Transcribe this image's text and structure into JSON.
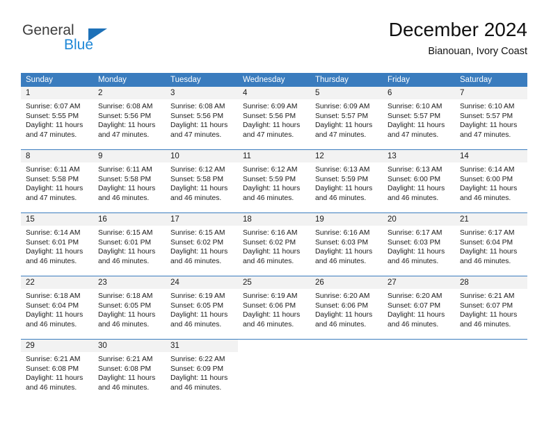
{
  "logo": {
    "word_top": "General",
    "word_bottom": "Blue",
    "triangle_color": "#1e71b8",
    "blue_color": "#1e87d6"
  },
  "header": {
    "month_title": "December 2024",
    "location": "Bianouan, Ivory Coast"
  },
  "theme": {
    "header_blue": "#3a7cbe",
    "day_number_bg": "#f2f2f2",
    "text": "#1a1a1a"
  },
  "calendar": {
    "weekdays": [
      "Sunday",
      "Monday",
      "Tuesday",
      "Wednesday",
      "Thursday",
      "Friday",
      "Saturday"
    ],
    "weeks": [
      [
        {
          "day": "1",
          "sunrise": "Sunrise: 6:07 AM",
          "sunset": "Sunset: 5:55 PM",
          "daylight1": "Daylight: 11 hours",
          "daylight2": "and 47 minutes."
        },
        {
          "day": "2",
          "sunrise": "Sunrise: 6:08 AM",
          "sunset": "Sunset: 5:56 PM",
          "daylight1": "Daylight: 11 hours",
          "daylight2": "and 47 minutes."
        },
        {
          "day": "3",
          "sunrise": "Sunrise: 6:08 AM",
          "sunset": "Sunset: 5:56 PM",
          "daylight1": "Daylight: 11 hours",
          "daylight2": "and 47 minutes."
        },
        {
          "day": "4",
          "sunrise": "Sunrise: 6:09 AM",
          "sunset": "Sunset: 5:56 PM",
          "daylight1": "Daylight: 11 hours",
          "daylight2": "and 47 minutes."
        },
        {
          "day": "5",
          "sunrise": "Sunrise: 6:09 AM",
          "sunset": "Sunset: 5:57 PM",
          "daylight1": "Daylight: 11 hours",
          "daylight2": "and 47 minutes."
        },
        {
          "day": "6",
          "sunrise": "Sunrise: 6:10 AM",
          "sunset": "Sunset: 5:57 PM",
          "daylight1": "Daylight: 11 hours",
          "daylight2": "and 47 minutes."
        },
        {
          "day": "7",
          "sunrise": "Sunrise: 6:10 AM",
          "sunset": "Sunset: 5:57 PM",
          "daylight1": "Daylight: 11 hours",
          "daylight2": "and 47 minutes."
        }
      ],
      [
        {
          "day": "8",
          "sunrise": "Sunrise: 6:11 AM",
          "sunset": "Sunset: 5:58 PM",
          "daylight1": "Daylight: 11 hours",
          "daylight2": "and 47 minutes."
        },
        {
          "day": "9",
          "sunrise": "Sunrise: 6:11 AM",
          "sunset": "Sunset: 5:58 PM",
          "daylight1": "Daylight: 11 hours",
          "daylight2": "and 46 minutes."
        },
        {
          "day": "10",
          "sunrise": "Sunrise: 6:12 AM",
          "sunset": "Sunset: 5:58 PM",
          "daylight1": "Daylight: 11 hours",
          "daylight2": "and 46 minutes."
        },
        {
          "day": "11",
          "sunrise": "Sunrise: 6:12 AM",
          "sunset": "Sunset: 5:59 PM",
          "daylight1": "Daylight: 11 hours",
          "daylight2": "and 46 minutes."
        },
        {
          "day": "12",
          "sunrise": "Sunrise: 6:13 AM",
          "sunset": "Sunset: 5:59 PM",
          "daylight1": "Daylight: 11 hours",
          "daylight2": "and 46 minutes."
        },
        {
          "day": "13",
          "sunrise": "Sunrise: 6:13 AM",
          "sunset": "Sunset: 6:00 PM",
          "daylight1": "Daylight: 11 hours",
          "daylight2": "and 46 minutes."
        },
        {
          "day": "14",
          "sunrise": "Sunrise: 6:14 AM",
          "sunset": "Sunset: 6:00 PM",
          "daylight1": "Daylight: 11 hours",
          "daylight2": "and 46 minutes."
        }
      ],
      [
        {
          "day": "15",
          "sunrise": "Sunrise: 6:14 AM",
          "sunset": "Sunset: 6:01 PM",
          "daylight1": "Daylight: 11 hours",
          "daylight2": "and 46 minutes."
        },
        {
          "day": "16",
          "sunrise": "Sunrise: 6:15 AM",
          "sunset": "Sunset: 6:01 PM",
          "daylight1": "Daylight: 11 hours",
          "daylight2": "and 46 minutes."
        },
        {
          "day": "17",
          "sunrise": "Sunrise: 6:15 AM",
          "sunset": "Sunset: 6:02 PM",
          "daylight1": "Daylight: 11 hours",
          "daylight2": "and 46 minutes."
        },
        {
          "day": "18",
          "sunrise": "Sunrise: 6:16 AM",
          "sunset": "Sunset: 6:02 PM",
          "daylight1": "Daylight: 11 hours",
          "daylight2": "and 46 minutes."
        },
        {
          "day": "19",
          "sunrise": "Sunrise: 6:16 AM",
          "sunset": "Sunset: 6:03 PM",
          "daylight1": "Daylight: 11 hours",
          "daylight2": "and 46 minutes."
        },
        {
          "day": "20",
          "sunrise": "Sunrise: 6:17 AM",
          "sunset": "Sunset: 6:03 PM",
          "daylight1": "Daylight: 11 hours",
          "daylight2": "and 46 minutes."
        },
        {
          "day": "21",
          "sunrise": "Sunrise: 6:17 AM",
          "sunset": "Sunset: 6:04 PM",
          "daylight1": "Daylight: 11 hours",
          "daylight2": "and 46 minutes."
        }
      ],
      [
        {
          "day": "22",
          "sunrise": "Sunrise: 6:18 AM",
          "sunset": "Sunset: 6:04 PM",
          "daylight1": "Daylight: 11 hours",
          "daylight2": "and 46 minutes."
        },
        {
          "day": "23",
          "sunrise": "Sunrise: 6:18 AM",
          "sunset": "Sunset: 6:05 PM",
          "daylight1": "Daylight: 11 hours",
          "daylight2": "and 46 minutes."
        },
        {
          "day": "24",
          "sunrise": "Sunrise: 6:19 AM",
          "sunset": "Sunset: 6:05 PM",
          "daylight1": "Daylight: 11 hours",
          "daylight2": "and 46 minutes."
        },
        {
          "day": "25",
          "sunrise": "Sunrise: 6:19 AM",
          "sunset": "Sunset: 6:06 PM",
          "daylight1": "Daylight: 11 hours",
          "daylight2": "and 46 minutes."
        },
        {
          "day": "26",
          "sunrise": "Sunrise: 6:20 AM",
          "sunset": "Sunset: 6:06 PM",
          "daylight1": "Daylight: 11 hours",
          "daylight2": "and 46 minutes."
        },
        {
          "day": "27",
          "sunrise": "Sunrise: 6:20 AM",
          "sunset": "Sunset: 6:07 PM",
          "daylight1": "Daylight: 11 hours",
          "daylight2": "and 46 minutes."
        },
        {
          "day": "28",
          "sunrise": "Sunrise: 6:21 AM",
          "sunset": "Sunset: 6:07 PM",
          "daylight1": "Daylight: 11 hours",
          "daylight2": "and 46 minutes."
        }
      ],
      [
        {
          "day": "29",
          "sunrise": "Sunrise: 6:21 AM",
          "sunset": "Sunset: 6:08 PM",
          "daylight1": "Daylight: 11 hours",
          "daylight2": "and 46 minutes."
        },
        {
          "day": "30",
          "sunrise": "Sunrise: 6:21 AM",
          "sunset": "Sunset: 6:08 PM",
          "daylight1": "Daylight: 11 hours",
          "daylight2": "and 46 minutes."
        },
        {
          "day": "31",
          "sunrise": "Sunrise: 6:22 AM",
          "sunset": "Sunset: 6:09 PM",
          "daylight1": "Daylight: 11 hours",
          "daylight2": "and 46 minutes."
        },
        {
          "day": "",
          "sunrise": "",
          "sunset": "",
          "daylight1": "",
          "daylight2": ""
        },
        {
          "day": "",
          "sunrise": "",
          "sunset": "",
          "daylight1": "",
          "daylight2": ""
        },
        {
          "day": "",
          "sunrise": "",
          "sunset": "",
          "daylight1": "",
          "daylight2": ""
        },
        {
          "day": "",
          "sunrise": "",
          "sunset": "",
          "daylight1": "",
          "daylight2": ""
        }
      ]
    ]
  }
}
